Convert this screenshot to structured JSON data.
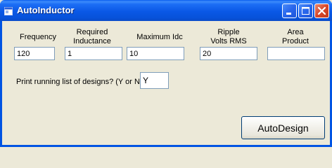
{
  "window": {
    "title": "AutoInductor",
    "icon": "app-window-icon",
    "controls": [
      "minimize-icon",
      "maximize-icon",
      "close-icon"
    ]
  },
  "fields": [
    {
      "label_lines": [
        "Frequency"
      ],
      "value": "120"
    },
    {
      "label_lines": [
        "Required",
        "Inductance"
      ],
      "value": "1"
    },
    {
      "label_lines": [
        "Maximum Idc"
      ],
      "value": "10"
    },
    {
      "label_lines": [
        "Ripple",
        "Volts RMS"
      ],
      "value": "20"
    },
    {
      "label_lines": [
        "Area",
        "Product"
      ],
      "value": ""
    }
  ],
  "print_prompt": {
    "label": "Print running list of designs? (Y or N):",
    "value": "Y"
  },
  "actions": {
    "autodesign_label": "AutoDesign"
  },
  "colors": {
    "titlebar": "#0a58e6",
    "window_bg": "#ece9d8",
    "close_button": "#d8472a",
    "field_border": "#7f9db9"
  }
}
